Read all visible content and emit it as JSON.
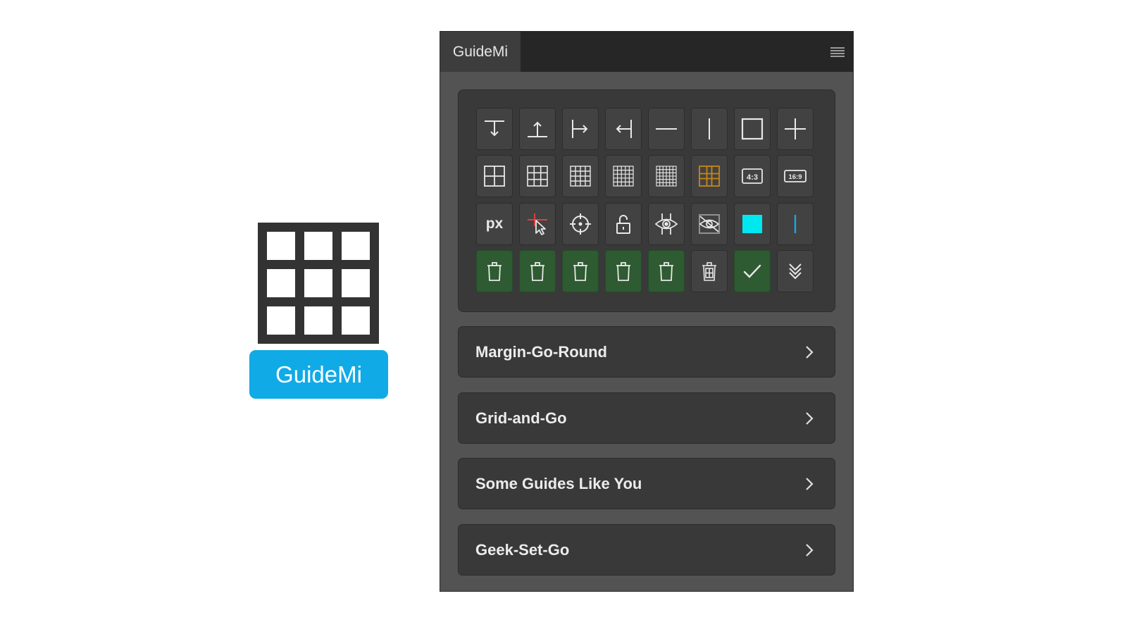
{
  "logo": {
    "badge_text": "GuideMi",
    "badge_color": "#10aae6"
  },
  "panel": {
    "tab_label": "GuideMi",
    "menu_icon": "hamburger-menu-icon",
    "toolbar": {
      "row1": [
        "guide-top-icon",
        "guide-bottom-icon",
        "guide-left-icon",
        "guide-right-icon",
        "horizontal-guide-icon",
        "vertical-guide-icon",
        "frame-guide-icon",
        "cross-guide-icon"
      ],
      "row2": [
        "grid-2x2-icon",
        "grid-3x3-icon",
        "grid-4x4-icon",
        "grid-5x5-icon",
        "grid-6x6-icon",
        "golden-grid-icon",
        "ratio-4-3-icon",
        "ratio-16-9-icon"
      ],
      "row3": [
        "pixel-units",
        "guide-cursor-icon",
        "crosshair-target-icon",
        "unlock-icon",
        "show-guides-icon",
        "hide-guides-icon",
        "guide-color-swatch",
        "guide-line-color-icon"
      ],
      "row4": [
        "clear-top-guides-icon",
        "clear-bottom-guides-icon",
        "clear-left-guides-icon",
        "clear-right-guides-icon",
        "clear-all-guides-icon",
        "clear-grid-icon",
        "apply-check-icon",
        "expand-more-icon"
      ],
      "px_label": "px",
      "ratio_4_3": "4:3",
      "ratio_16_9": "16:9",
      "swatch_color": "#00e8ef",
      "line_color": "#19a8e0",
      "golden_color": "#c8861a",
      "cursor_accent": "#e23c3c"
    },
    "sections": [
      {
        "label": "Margin-Go-Round"
      },
      {
        "label": "Grid-and-Go"
      },
      {
        "label": "Some Guides Like You"
      },
      {
        "label": "Geek-Set-Go"
      }
    ]
  }
}
